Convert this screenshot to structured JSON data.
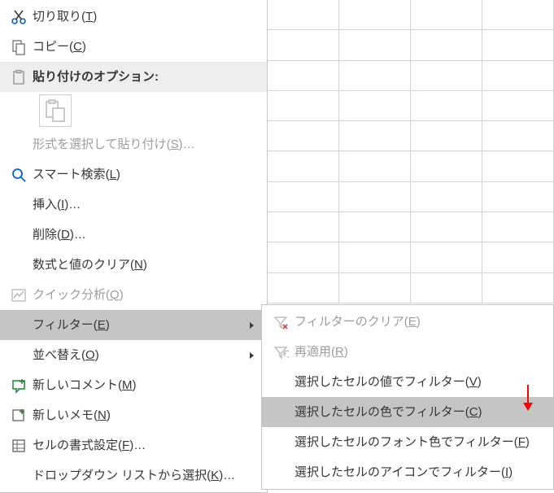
{
  "menu": {
    "cut": "切り取り",
    "cut_key": "T",
    "copy": "コピー",
    "copy_key": "C",
    "paste_opts_header": "貼り付けのオプション:",
    "paste_special": "形式を選択して貼り付け",
    "paste_special_key": "S",
    "ellipsis": "…",
    "smart_lookup": "スマート検索",
    "smart_lookup_key": "L",
    "insert": "挿入",
    "insert_key": "I",
    "delete": "削除",
    "delete_key": "D",
    "clear": "数式と値のクリア",
    "clear_key": "N",
    "quick_analysis": "クイック分析",
    "quick_analysis_key": "Q",
    "filter": "フィルター",
    "filter_key": "E",
    "sort": "並べ替え",
    "sort_key": "O",
    "new_comment": "新しいコメント",
    "new_comment_key": "M",
    "new_note": "新しいメモ",
    "new_note_key": "N",
    "format_cells": "セルの書式設定",
    "format_cells_key": "F",
    "dropdown_list": "ドロップダウン リストから選択",
    "dropdown_list_key": "K"
  },
  "submenu": {
    "clear_filter": "フィルターのクリア",
    "clear_filter_key": "E",
    "reapply": "再適用",
    "reapply_key": "R",
    "filter_by_value": "選択したセルの値でフィルター",
    "filter_by_value_key": "V",
    "filter_by_color": "選択したセルの色でフィルター",
    "filter_by_color_key": "C",
    "filter_by_font_color": "選択したセルのフォント色でフィルター",
    "filter_by_font_color_key": "F",
    "filter_by_icon": "選択したセルのアイコンでフィルター",
    "filter_by_icon_key": "I"
  }
}
